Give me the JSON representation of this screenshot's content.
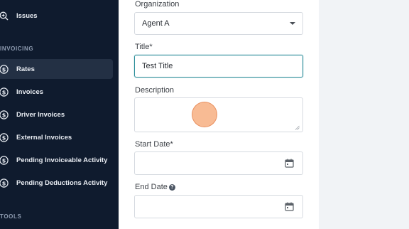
{
  "sidebar": {
    "items": [
      {
        "label": "Issues",
        "icon": "magnifier-plus-icon",
        "active": false
      },
      {
        "label": "Rates",
        "icon": "dollar-circle-icon",
        "active": true
      },
      {
        "label": "Invoices",
        "icon": "dollar-circle-icon",
        "active": false
      },
      {
        "label": "Driver Invoices",
        "icon": "dollar-circle-icon",
        "active": false
      },
      {
        "label": "External Invoices",
        "icon": "dollar-circle-icon",
        "active": false
      },
      {
        "label": "Pending Invoiceable Activity",
        "icon": "dollar-circle-icon",
        "active": false
      },
      {
        "label": "Pending Deductions Activity",
        "icon": "dollar-circle-icon",
        "active": false
      }
    ],
    "sections": {
      "invoicing": "INVOICING",
      "tools": "TOOLS"
    }
  },
  "form": {
    "organization": {
      "label": "Organization",
      "value": "Agent A"
    },
    "title": {
      "label": "Title*",
      "value": "Test Title"
    },
    "description": {
      "label": "Description",
      "value": ""
    },
    "start_date": {
      "label": "Start Date*",
      "value": ""
    },
    "end_date": {
      "label": "End Date",
      "value": "",
      "help": "?"
    }
  },
  "colors": {
    "sidebar_bg": "#0f1b2e",
    "sidebar_active": "#233044",
    "focus_border": "#2f8f9b",
    "cursor_highlight": "#f6a876"
  }
}
